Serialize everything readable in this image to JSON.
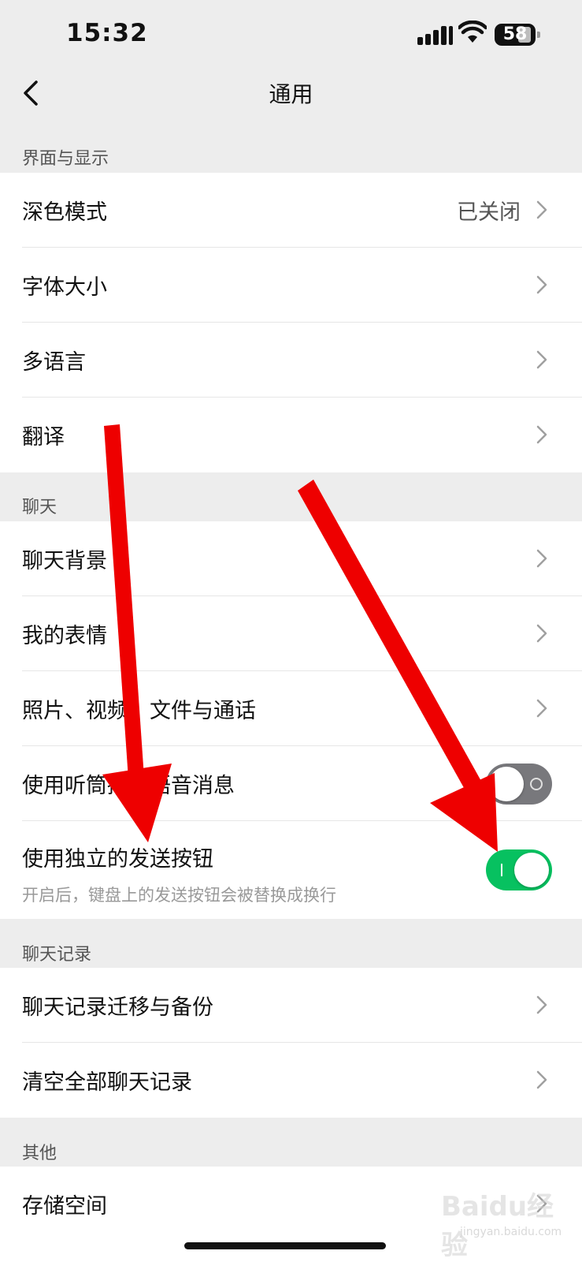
{
  "status_bar": {
    "time": "15:32",
    "battery": "58"
  },
  "nav": {
    "title": "通用"
  },
  "sections": [
    {
      "header": "界面与显示",
      "items": [
        {
          "label": "深色模式",
          "value": "已关闭"
        },
        {
          "label": "字体大小"
        },
        {
          "label": "多语言"
        },
        {
          "label": "翻译"
        }
      ]
    },
    {
      "header": "聊天",
      "items": [
        {
          "label": "聊天背景"
        },
        {
          "label": "我的表情"
        },
        {
          "label": "照片、视频、文件与通话"
        },
        {
          "label": "使用听筒播放语音消息",
          "toggle": "off"
        },
        {
          "label": "使用独立的发送按钮",
          "toggle": "on",
          "subtitle": "开启后，键盘上的发送按钮会被替换成换行"
        }
      ]
    },
    {
      "header": "聊天记录",
      "items": [
        {
          "label": "聊天记录迁移与备份"
        },
        {
          "label": "清空全部聊天记录"
        }
      ]
    },
    {
      "header": "其他",
      "items": [
        {
          "label": "存储空间"
        }
      ]
    }
  ],
  "watermark": {
    "text": "Baidu经验",
    "sub": "jingyan.baidu.com"
  },
  "icons": {
    "back": "chevron-left-icon",
    "row": "chevron-right-icon",
    "wifi": "wifi-icon",
    "signal": "signal-icon",
    "battery": "battery-icon"
  },
  "colors": {
    "accent_green": "#07c160",
    "toggle_off": "#78787c",
    "annotation_arrow": "#ee0000"
  }
}
